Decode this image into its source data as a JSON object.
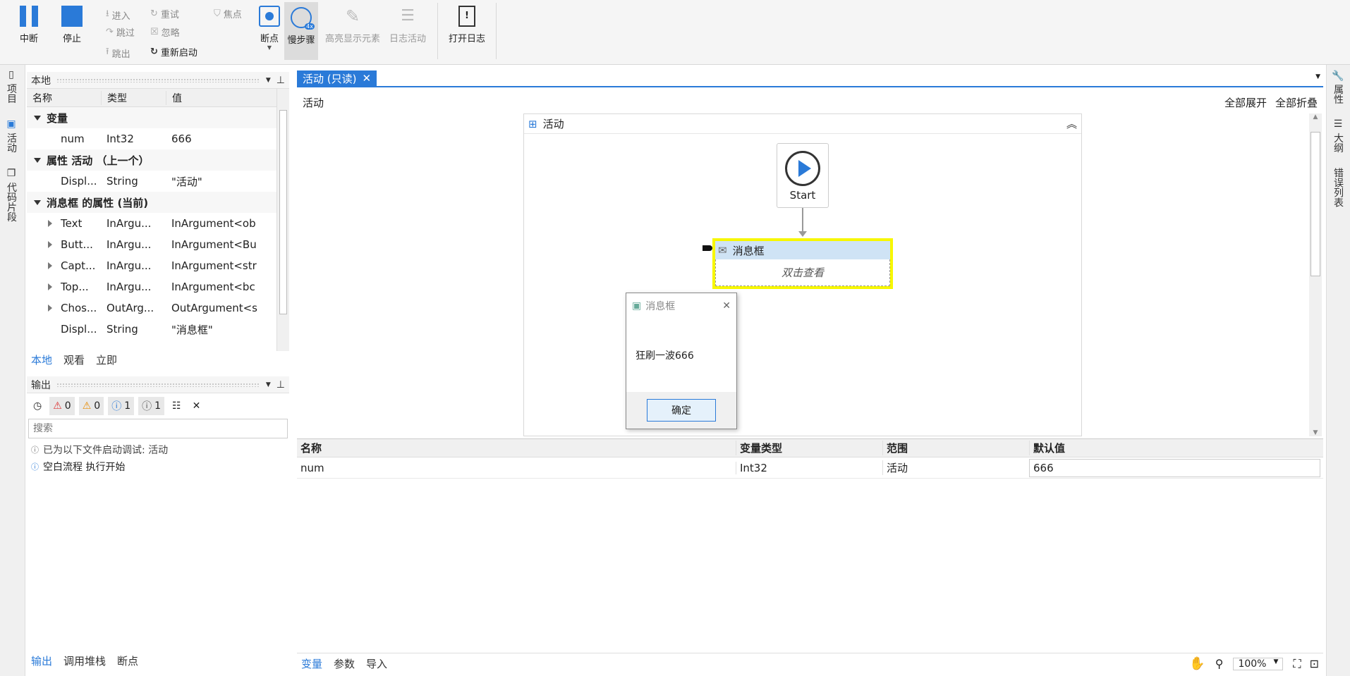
{
  "ribbon": {
    "break_label": "中断",
    "stop_label": "停止",
    "step_into": "进入",
    "step_over": "跳过",
    "step_out": "跳出",
    "retry": "重试",
    "ignore": "忽略",
    "restart": "重新启动",
    "focus": "焦点",
    "breakpoint": "断点",
    "slow_step": "慢步骤",
    "slow_step_badge": "4x",
    "highlight": "高亮显示元素",
    "log_activity": "日志活动",
    "open_log": "打开日志"
  },
  "left_sidebar": {
    "tabs": [
      "项目",
      "活动",
      "代码片段"
    ]
  },
  "right_sidebar": {
    "tabs": [
      "属性",
      "大纲",
      "错误列表"
    ]
  },
  "locals": {
    "title": "本地",
    "columns": [
      "名称",
      "类型",
      "值"
    ],
    "groups": [
      {
        "label": "变量",
        "rows": [
          {
            "name": "num",
            "type": "Int32",
            "value": "666",
            "expandable": false
          }
        ]
      },
      {
        "label": "属性 活动 （上一个）",
        "rows": [
          {
            "name": "Displ...",
            "type": "String",
            "value": "\"活动\"",
            "expandable": false
          }
        ]
      },
      {
        "label": "消息框 的属性 (当前)",
        "rows": [
          {
            "name": "Text",
            "type": "InArgu...",
            "value": "InArgument<ob",
            "expandable": true
          },
          {
            "name": "Butt...",
            "type": "InArgu...",
            "value": "InArgument<Bu",
            "expandable": true
          },
          {
            "name": "Capt...",
            "type": "InArgu...",
            "value": "InArgument<str",
            "expandable": true
          },
          {
            "name": "Top...",
            "type": "InArgu...",
            "value": "InArgument<bc",
            "expandable": true
          },
          {
            "name": "Chos...",
            "type": "OutArg...",
            "value": "OutArgument<s",
            "expandable": true
          },
          {
            "name": "Displ...",
            "type": "String",
            "value": "\"消息框\"",
            "expandable": false
          }
        ]
      }
    ],
    "bottom_tabs": [
      "本地",
      "观看",
      "立即"
    ]
  },
  "output": {
    "title": "输出",
    "errors": "0",
    "warnings": "0",
    "info": "1",
    "trace": "1",
    "search_placeholder": "搜索",
    "lines": [
      "已为以下文件启动调试: 活动",
      "空白流程 执行开始"
    ],
    "bottom_tabs": [
      "输出",
      "调用堆栈",
      "断点"
    ]
  },
  "document": {
    "tab_label": "活动 (只读)",
    "breadcrumb": "活动",
    "expand_all": "全部展开",
    "collapse_all": "全部折叠"
  },
  "designer": {
    "sequence_title": "活动",
    "start_label": "Start",
    "activity_title": "消息框",
    "activity_hint": "双击查看"
  },
  "dialog": {
    "title": "消息框",
    "message": "狂刷一波666",
    "ok": "确定"
  },
  "variables": {
    "columns": [
      "名称",
      "变量类型",
      "范围",
      "默认值"
    ],
    "rows": [
      {
        "name": "num",
        "type": "Int32",
        "scope": "活动",
        "default": "666"
      }
    ]
  },
  "bottom_bar": {
    "tabs": [
      "变量",
      "参数",
      "导入"
    ],
    "zoom": "100%"
  },
  "colors": {
    "accent": "#2a7ad8",
    "selection": "#f7f700",
    "header_blue": "#cfe3f5"
  }
}
